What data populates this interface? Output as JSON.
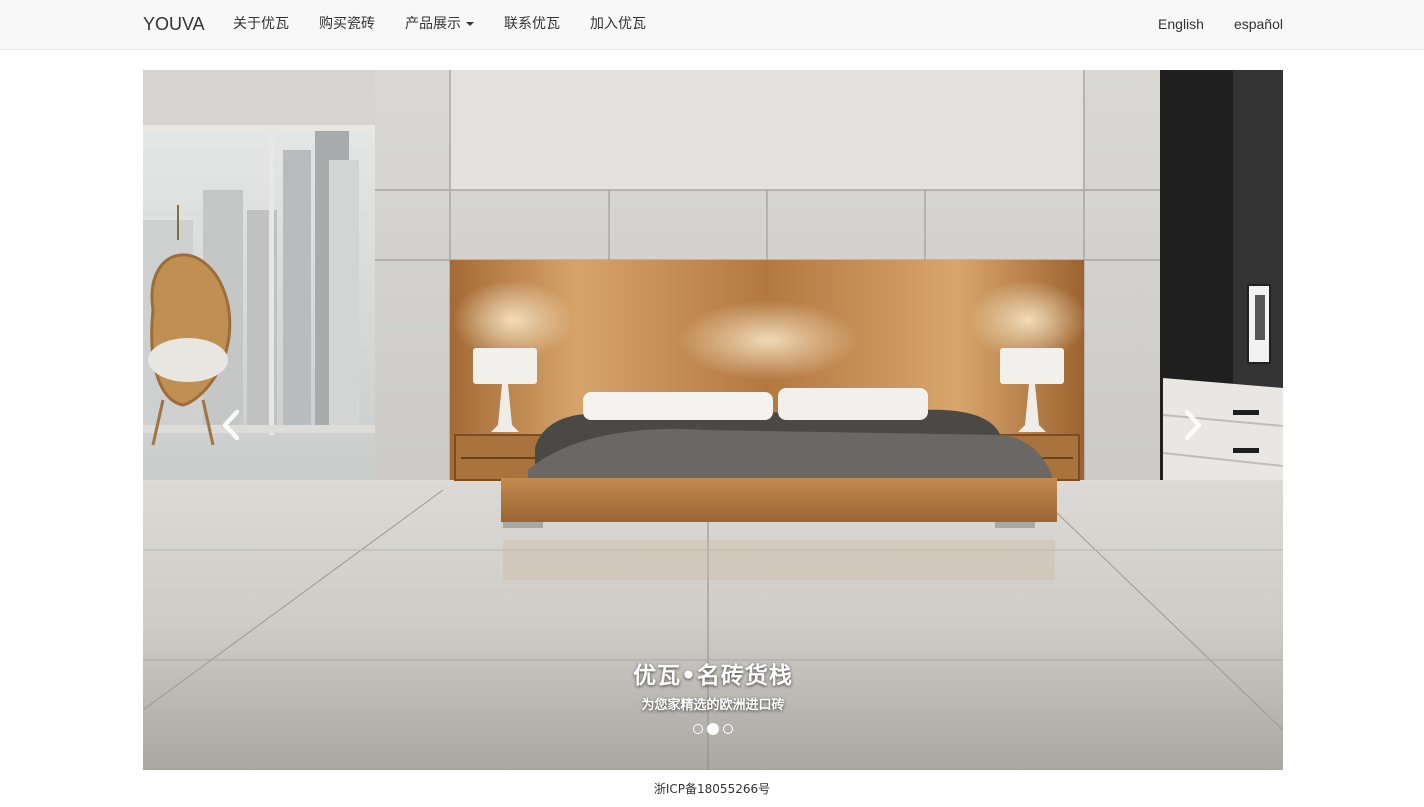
{
  "navbar": {
    "brand": "YOUVA",
    "items": [
      {
        "label": "关于优瓦"
      },
      {
        "label": "购买瓷砖"
      },
      {
        "label": "产品展示"
      },
      {
        "label": "联系优瓦"
      },
      {
        "label": "加入优瓦"
      }
    ],
    "languages": [
      {
        "label": "English"
      },
      {
        "label": "español"
      }
    ]
  },
  "carousel": {
    "caption_title": "优瓦•名砖货栈",
    "caption_subtitle": "为您家精选的欧洲进口砖",
    "slide_count": 3,
    "active_slide": 2,
    "prev_icon": "chevron-left-icon",
    "next_icon": "chevron-right-icon"
  },
  "footer": {
    "icp": "浙ICP备18055266号"
  },
  "colors": {
    "navbar_bg": "#f8f8f8",
    "navbar_border": "#e7e7e7",
    "text": "#333333",
    "caption": "#ffffff"
  }
}
